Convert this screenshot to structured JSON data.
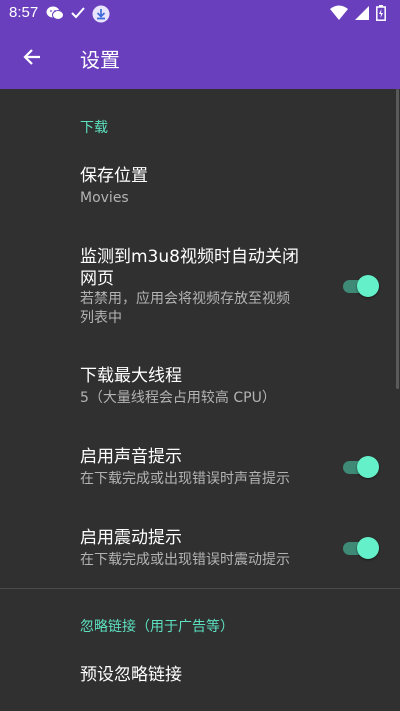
{
  "status": {
    "time": "8:57"
  },
  "appbar": {
    "title": "设置"
  },
  "download": {
    "category": "下载",
    "save_location": {
      "title": "保存位置",
      "summary": "Movies"
    },
    "auto_close": {
      "title_line1": "监测到m3u8视频时自动关闭",
      "title_line2": "网页",
      "summary_line1": "若禁用，应用会将视频存放至视频",
      "summary_line2": "列表中",
      "enabled": true
    },
    "max_threads": {
      "title": "下载最大线程",
      "summary": "5（大量线程会占用较高 CPU）"
    },
    "sound": {
      "title": "启用声音提示",
      "summary": "在下载完成或出现错误时声音提示",
      "enabled": true
    },
    "vibration": {
      "title": "启用震动提示",
      "summary": "在下载完成或出现错误时震动提示",
      "enabled": true
    }
  },
  "ignore": {
    "category": "忽略链接（用于广告等）",
    "preset": {
      "title": "预设忽略链接"
    }
  },
  "colors": {
    "primary": "#6a3fbe",
    "accent": "#64f0c8",
    "background": "#303030"
  },
  "icons": [
    "wechat-icon",
    "check-icon",
    "download-icon",
    "wifi-icon",
    "signal-icon",
    "battery-icon",
    "back-arrow-icon"
  ]
}
